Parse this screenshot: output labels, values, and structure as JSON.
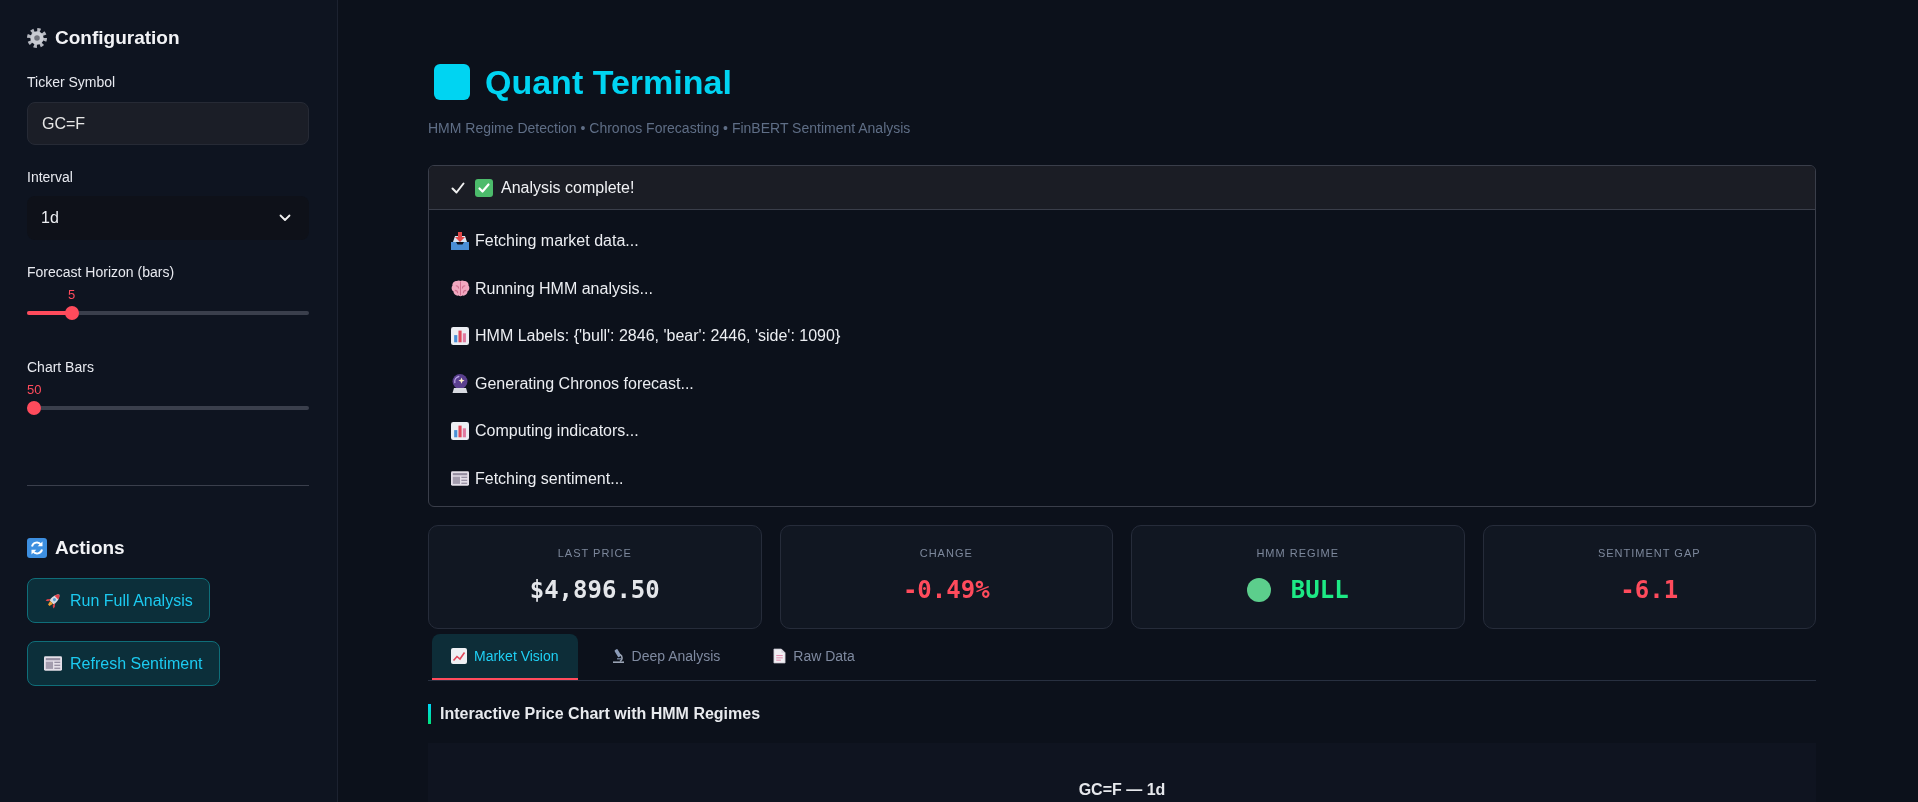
{
  "sidebar": {
    "config_title": "Configuration",
    "ticker": {
      "label": "Ticker Symbol",
      "value": "GC=F"
    },
    "interval": {
      "label": "Interval",
      "value": "1d"
    },
    "sliders": [
      {
        "label": "Forecast Horizon (bars)",
        "reading": "5",
        "level": 0.14
      },
      {
        "label": "Chart Bars",
        "reading": "50",
        "level": 0
      }
    ],
    "actions_title": "Actions",
    "buttons": [
      "Run Full Analysis",
      "Refresh Sentiment"
    ]
  },
  "header": {
    "title": "Quant Terminal",
    "subtitle": "HMM Regime Detection • Chronos Forecasting • FinBERT Sentiment Analysis"
  },
  "status": {
    "label": "Analysis complete!",
    "steps": [
      "Fetching market data...",
      "Running HMM analysis...",
      "HMM Labels: {'bull': 2846, 'bear': 2446, 'side': 1090}",
      "Generating Chronos forecast...",
      "Computing indicators...",
      "Fetching sentiment..."
    ]
  },
  "metrics": [
    {
      "label": "LAST PRICE",
      "value": "$4,896.50",
      "color": "#e4e6ea"
    },
    {
      "label": "CHANGE",
      "value": "-0.49%",
      "color": "#ff4b5c"
    },
    {
      "label": "HMM REGIME",
      "value": "BULL",
      "color": "#1de985"
    },
    {
      "label": "SENTIMENT GAP",
      "value": "-6.1",
      "color": "#ff4b5c"
    }
  ],
  "tabs": [
    {
      "label": "Market Vision",
      "selected": true
    },
    {
      "label": "Deep Analysis",
      "selected": false
    },
    {
      "label": "Raw Data",
      "selected": false
    }
  ],
  "section_title": "Interactive Price Chart with HMM Regimes",
  "chart": {
    "title": "GC=F — 1d"
  }
}
